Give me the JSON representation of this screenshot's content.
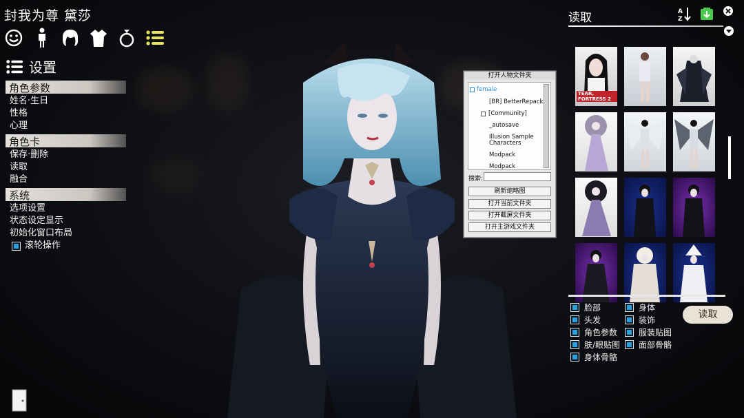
{
  "header": {
    "title": "封我为尊 黛莎"
  },
  "toolbar": {
    "icons": [
      "face-icon",
      "body-icon",
      "hair-icon",
      "clothes-icon",
      "accessory-ring-icon",
      "system-list-icon"
    ],
    "active_color": "#e8e35a"
  },
  "settings": {
    "label": "设置"
  },
  "menu": {
    "categories": [
      {
        "label": "角色参数",
        "items": [
          "姓名·生日",
          "性格",
          "心理"
        ]
      },
      {
        "label": "角色卡",
        "items": [
          "保存·删除",
          "读取",
          "融合"
        ]
      },
      {
        "label": "系统",
        "items": [
          "选项设置",
          "状态设定显示",
          "初始化窗口布局"
        ]
      }
    ],
    "wheel_label": "滚轮操作"
  },
  "folder_popup": {
    "title": "打开人物文件夹",
    "tree": [
      "female",
      "[BR] BetterRepack",
      "[Community]",
      "_autosave",
      "Illusion Sample Characters",
      "Modpack",
      "Modpack"
    ],
    "search_label": "搜索:",
    "buttons": [
      "刷新缩略图",
      "打开当前文件夹",
      "打开截屏文件夹",
      "打开主游戏文件夹"
    ]
  },
  "load_panel": {
    "title": "读取",
    "sort_icon": "sort-az-icon",
    "card_label": "TEAR, FORTRESS 2",
    "options": [
      "脸部",
      "身体",
      "头发",
      "装饰",
      "角色参数",
      "服装贴图",
      "肤/眼贴图",
      "面部骨骼",
      "身体骨骼"
    ],
    "load_button": "读取"
  },
  "colors": {
    "accent": "#2aa0e0",
    "cat_bg": "#d9d4ce",
    "load_btn_bg": "#e9e2d6"
  }
}
